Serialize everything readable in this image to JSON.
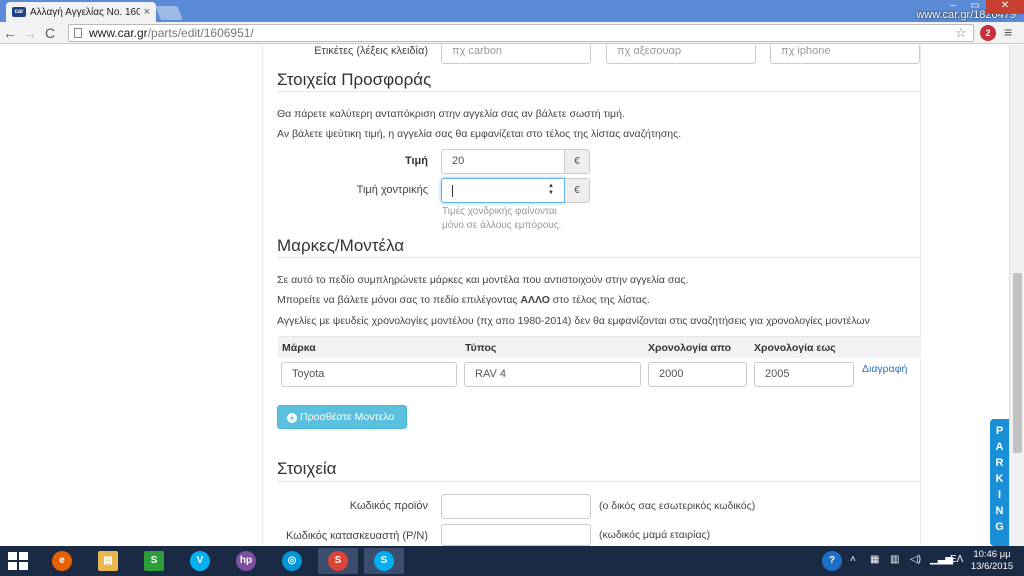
{
  "browser": {
    "tab_title": "Αλλαγή Αγγελίας Νο. 160",
    "tab_close": "×",
    "favicon_text": "car",
    "watermark": "www.car.gr/1820479",
    "url_host": "www.car.gr",
    "url_path": "/parts/edit/1606951/",
    "back_icon": "←",
    "forward_icon": "→",
    "reload_icon": "C",
    "star_icon": "☆",
    "ext_badge": "2",
    "menu_icon": "≡",
    "win_min": "–",
    "win_max": "▭",
    "win_close": "✕"
  },
  "tags": {
    "label": "Ετικέτες (λέξεις κλειδία)",
    "placeholders": [
      "πχ carbon",
      "πχ αξεσουαρ",
      "πχ iphone"
    ]
  },
  "offer": {
    "title": "Στοιχεία Προσφοράς",
    "intro1": "Θα πάρετε καλύτερη ανταπόκριση στην αγγελία σας αν βάλετε σωστή τιμή.",
    "intro2": "Αν βάλετε ψεύτικη τιμή, η αγγελία σας θα εμφανίζεται στο τέλος της λίστας αναζήτησης.",
    "price_label": "Τιμή",
    "price_value": "20",
    "currency": "€",
    "wholesale_label": "Τιμή χοντρικής",
    "wholesale_value": "",
    "wholesale_help_1": "Τιμές χονδρικής φαίνονται",
    "wholesale_help_2": "μόνο σε άλλους εμπόρους."
  },
  "models": {
    "title": "Μαρκες/Μοντέλα",
    "intro1": "Σε αυτό το πεδίο συμπληρώνετε μάρκες και μοντέλα που αντιστοιχούν στην αγγελία σας.",
    "intro2_pre": "Μπορείτε να βάλετε μόνοι σας το πεδίο επιλέγοντας ",
    "intro2_bold": "ΑΛΛΟ",
    "intro2_post": " στο τέλος της λίστας.",
    "intro3": "Αγγελίες με ψευδείς χρονολογίες μοντέλου (πχ απο 1980-2014) δεν θα εμφανίζονται στις αναζητήσεις για χρονολογίες μοντέλων",
    "columns": [
      "Μάρκα",
      "Τύπος",
      "Χρονολογία απο",
      "Χρονολογία εως"
    ],
    "rows": [
      {
        "make": "Toyota",
        "type": "RAV 4",
        "year_from": "2000",
        "year_to": "2005",
        "delete": "Διαγραφή"
      }
    ],
    "add_button": "Προσθέστε Μοντελο"
  },
  "details": {
    "title": "Στοιχεία",
    "product_code_label": "Κωδικός προϊόν",
    "product_code_help": "(ο δικός σας εσωτερικός κωδικός)",
    "pn_label": "Κωδικός κατασκευαστή (P/N)",
    "pn_help": "(κωδικός μαμά εταιρίας)"
  },
  "parking": [
    "P",
    "A",
    "R",
    "K",
    "I",
    "N",
    "G"
  ],
  "taskbar": {
    "apps": [
      "e",
      "▤",
      "S",
      "V",
      "hp",
      "◎",
      "S"
    ],
    "lang": "ΕΛ",
    "time": "10:46 μμ",
    "date": "13/6/2015",
    "help": "?"
  }
}
